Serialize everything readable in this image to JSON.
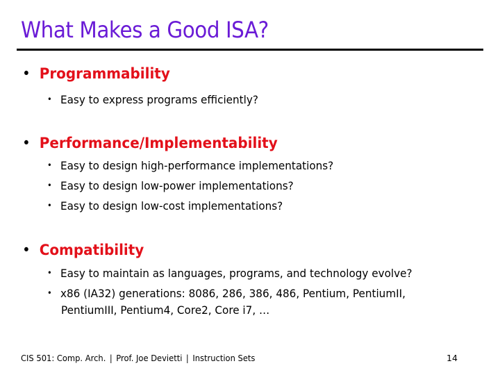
{
  "slide": {
    "title": "What Makes a Good ISA?",
    "colors": {
      "title": "#6A1BD6",
      "heading": "#E3101A",
      "text": "#000000"
    },
    "sections": [
      {
        "heading": "Programmability",
        "bullets": [
          "Easy to express programs efficiently?"
        ]
      },
      {
        "heading": "Performance/Implementability",
        "bullets": [
          "Easy to design high-performance implementations?",
          "Easy to design low-power implementations?",
          "Easy to design low-cost implementations?"
        ]
      },
      {
        "heading": "Compatibility",
        "bullets": [
          "Easy to maintain as languages, programs, and technology evolve?",
          "x86 (IA32) generations: 8086, 286, 386, 486, Pentium, PentiumII,"
        ],
        "continuation": "PentiumIII, Pentium4, Core2, Core i7, …"
      }
    ],
    "footer": {
      "course": "CIS 501: Comp. Arch.",
      "separator": "|",
      "instructor": "Prof. Joe Devietti",
      "topic": "Instruction Sets",
      "page_number": "14"
    },
    "bullet_glyph": "•"
  }
}
